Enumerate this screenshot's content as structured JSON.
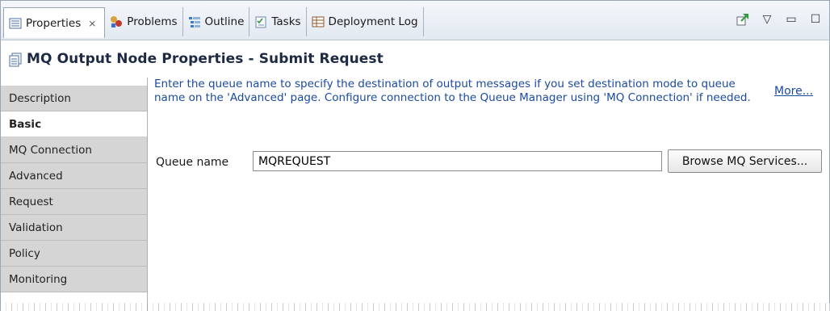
{
  "tabs": [
    {
      "label": "Properties",
      "icon": "properties-icon",
      "active": true,
      "close": "⨯"
    },
    {
      "label": "Problems",
      "icon": "problems-icon",
      "active": false
    },
    {
      "label": "Outline",
      "icon": "outline-icon",
      "active": false
    },
    {
      "label": "Tasks",
      "icon": "tasks-icon",
      "active": false
    },
    {
      "label": "Deployment Log",
      "icon": "deployment-log-icon",
      "active": false
    }
  ],
  "view_tools": {
    "pin_icon": "pin-icon",
    "menu_glyph": "▽",
    "minimize_glyph": "▭",
    "maximize_glyph": "☐"
  },
  "header": {
    "title": "MQ Output Node Properties - Submit Request",
    "icon": "node-properties-icon"
  },
  "sidebar": {
    "items": [
      {
        "label": "Description"
      },
      {
        "label": "Basic"
      },
      {
        "label": "MQ Connection"
      },
      {
        "label": "Advanced"
      },
      {
        "label": "Request"
      },
      {
        "label": "Validation"
      },
      {
        "label": "Policy"
      },
      {
        "label": "Monitoring"
      }
    ],
    "selected": "Basic"
  },
  "main": {
    "description": "Enter the queue name to specify the destination of output messages if you set destination mode to queue name on the 'Advanced' page. Configure connection to the Queue Manager using 'MQ Connection' if needed.",
    "more_link": "More...",
    "queue_label": "Queue name",
    "queue_value": "MQREQUEST",
    "browse_label": "Browse MQ Services..."
  },
  "colors": {
    "title": "#1e2a44",
    "description": "#1b4aa0",
    "sidebar_bg": "#d5d5d5"
  }
}
